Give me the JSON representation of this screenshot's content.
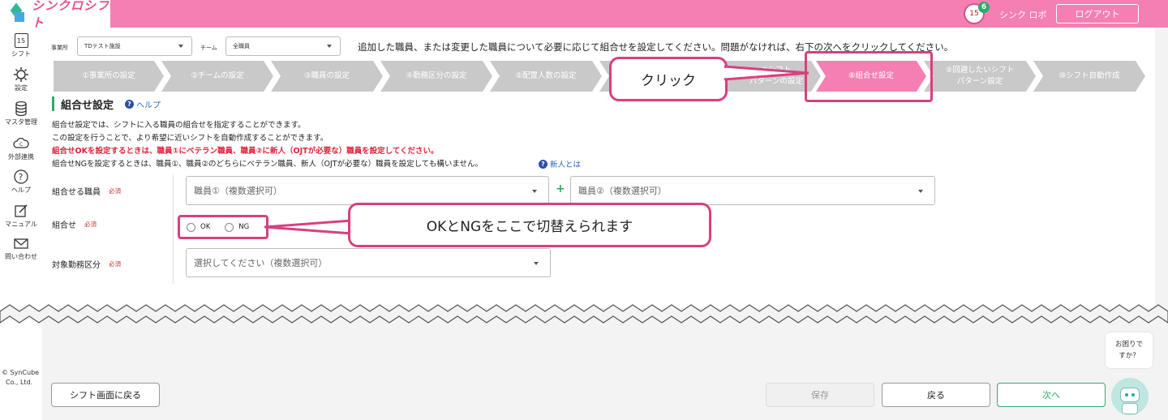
{
  "header": {
    "logo_text": "シンクロシフト",
    "notification_count": "6",
    "calendar_day": "15",
    "user_name": "シンク ロボ",
    "logout_label": "ログアウト"
  },
  "sidebar": {
    "items": [
      {
        "label": "シフト",
        "icon": "calendar-icon",
        "day": "15"
      },
      {
        "label": "設定",
        "icon": "gear-icon"
      },
      {
        "label": "マスタ管理",
        "icon": "database-icon"
      },
      {
        "label": "外部連携",
        "icon": "cloud-icon"
      },
      {
        "label": "ヘルプ",
        "icon": "question-icon"
      },
      {
        "label": "マニュアル",
        "icon": "manual-icon"
      },
      {
        "label": "問い合わせ",
        "icon": "mail-icon"
      }
    ],
    "copyright_line1": "© SynCube",
    "copyright_line2": "Co., Ltd."
  },
  "filters": {
    "office_label": "事業所",
    "office_value": "TDテスト施設",
    "team_label": "チーム",
    "team_value": "全職員"
  },
  "instruction": "追加した職員、または変更した職員について必要に応じて組合せを設定してください。問題がなければ、右下の次へをクリックしてください。",
  "steps": [
    {
      "label": "①事業所の設定"
    },
    {
      "label": "②チームの設定"
    },
    {
      "label": "③職員の設定"
    },
    {
      "label": "④勤務区分の設定"
    },
    {
      "label": "⑤配置人数の設定"
    },
    {
      "label": ""
    },
    {
      "label": "⑦シフト\nパターンの設定"
    },
    {
      "label": "⑧組合せ設定"
    },
    {
      "label": "⑨回避したいシフト\nパターン設定"
    },
    {
      "label": "⑩シフト自動作成"
    }
  ],
  "section": {
    "title": "組合せ設定",
    "help_label": "ヘルプ"
  },
  "description": {
    "line1": "組合せ設定では、シフトに入る職員の組合せを指定することができます。",
    "line2": "この設定を行うことで、より希望に近いシフトを自動作成することができます。",
    "line3": "組合せOKを設定するときは、職員①にベテラン職員、職員②に新人（OJTが必要な）職員を設定してください。",
    "line4": "組合せNGを設定するときは、職員①、職員②のどちらにベテラン職員、新人（OJTが必要な）職員を設定しても構いません。",
    "newbie_link": "新人とは"
  },
  "form": {
    "staff_label": "組合せる職員",
    "required": "必須",
    "staff1_placeholder": "職員①（複数選択可）",
    "staff2_placeholder": "職員②（複数選択可）",
    "combo_label": "組合せ",
    "ok_label": "OK",
    "ng_label": "NG",
    "shift_label": "対象勤務区分",
    "shift_placeholder": "選択してください（複数選択可）"
  },
  "callouts": {
    "click": "クリック",
    "toggle": "OKとNGをここで切替えられます"
  },
  "buttons": {
    "back_to_shift": "シフト画面に戻る",
    "save": "保存",
    "back": "戻る",
    "next": "次へ"
  },
  "help_bubble": "お困りで\nすか？",
  "colors": {
    "brand_pink": "#f57fb2",
    "highlight": "#d8407f",
    "accent_green": "#2eaa6c",
    "step_inactive": "#c9c9c9",
    "warning_red": "#e0203a"
  }
}
